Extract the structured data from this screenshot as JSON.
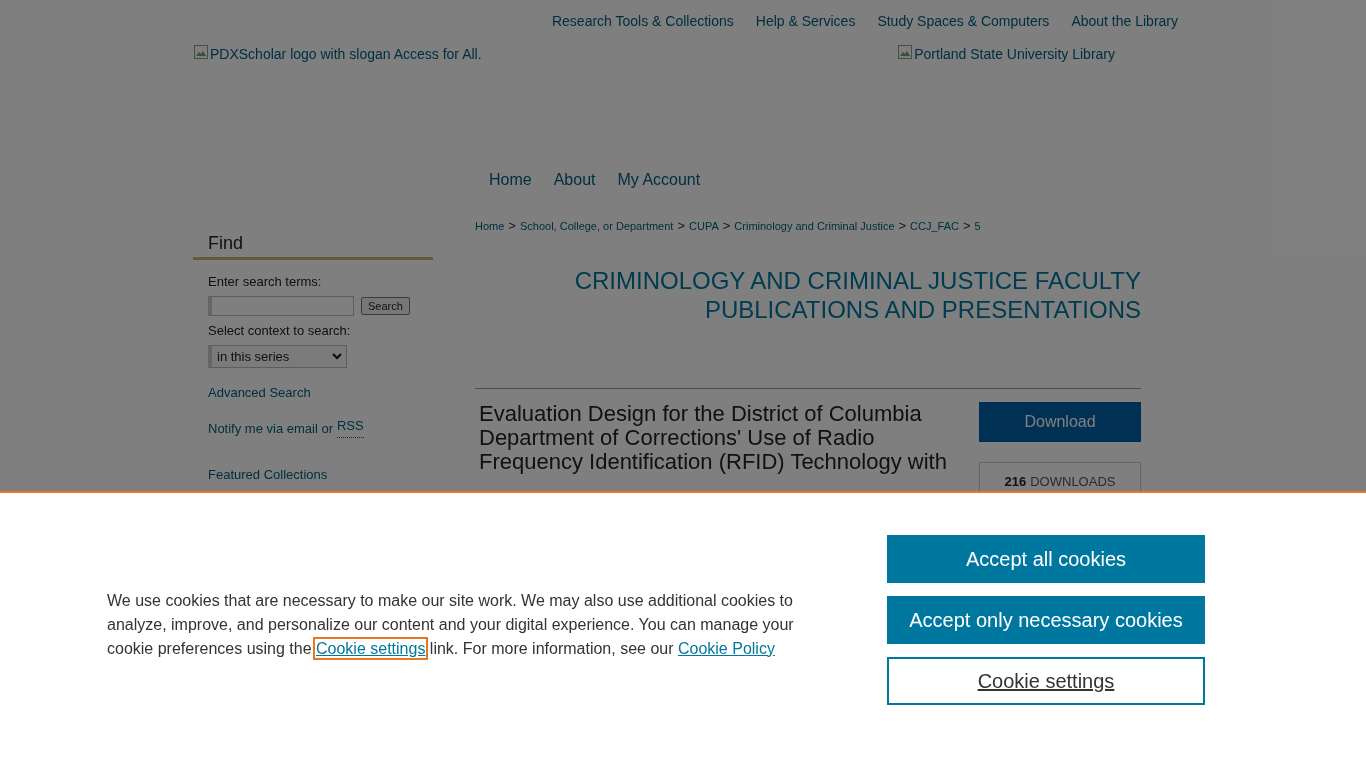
{
  "header": {
    "top_links": [
      "Research Tools & Collections",
      "Help & Services",
      "Study Spaces & Computers",
      "About the Library"
    ],
    "logo_left_alt": "PDXScholar logo with slogan Access for All.",
    "logo_right_alt": "Portland State University Library"
  },
  "nav": [
    "Home",
    "About",
    "My Account"
  ],
  "sidebar": {
    "heading": "Find",
    "search_label": "Enter search terms:",
    "search_button": "Search",
    "context_label": "Select context to search:",
    "context_value": "in this series",
    "advanced_search": "Advanced Search",
    "notify_text": "Notify me via email or",
    "notify_rss": "RSS",
    "featured_collections": "Featured Collections"
  },
  "breadcrumb": [
    {
      "label": "Home",
      "separator": ">"
    },
    {
      "label": "School, College, or Department",
      "separator": ">"
    },
    {
      "label": "CUPA",
      "separator": ">"
    },
    {
      "label": "Criminology and Criminal Justice",
      "separator": ">"
    },
    {
      "label": "CCJ_FAC",
      "separator": ">"
    },
    {
      "label": "5"
    }
  ],
  "series_title": [
    "CRIMINOLOGY AND CRIMINAL JUSTICE FACULTY",
    "PUBLICATIONS AND PRESENTATIONS"
  ],
  "article": {
    "title": "Evaluation Design for the District of Columbia Department of Corrections' Use of Radio Frequency Identification (RFID) Technology with",
    "download_label": "Download",
    "downloads_count": "216",
    "downloads_label": "DOWNLOADS"
  },
  "cookie_banner": {
    "text_before": "We use cookies that are necessary to make our site work. We may also use additional cookies to analyze, improve, and personalize our content and your digital experience. You can manage your cookie preferences using the",
    "settings_link": {
      "label": "Cookie settings",
      "focused": true
    },
    "text_middle": "link. For more information, see our",
    "policy_link": "Cookie Policy",
    "buttons": [
      {
        "label": "Accept all cookies",
        "kind": "filled"
      },
      {
        "label": "Accept only necessary cookies",
        "kind": "filled"
      },
      {
        "label": "Cookie settings",
        "kind": "outline"
      }
    ]
  }
}
